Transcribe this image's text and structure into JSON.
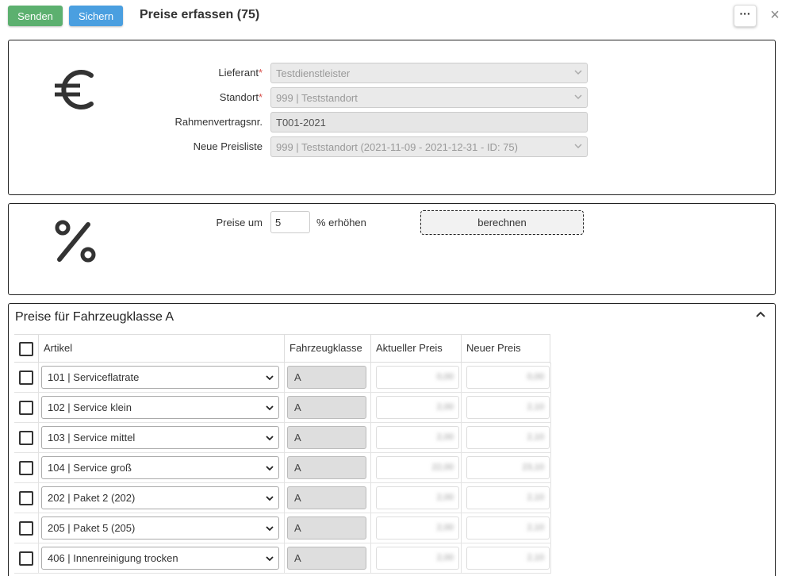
{
  "toolbar": {
    "send_label": "Senden",
    "save_label": "Sichern",
    "title": "Preise erfassen (75)",
    "more_label": "···",
    "close_label": "×"
  },
  "form": {
    "supplier": {
      "label": "Lieferant",
      "required": "*",
      "value": "Testdienstleister"
    },
    "location": {
      "label": "Standort",
      "required": "*",
      "value": "999 | Teststandort"
    },
    "contract": {
      "label": "Rahmenvertragsnr.",
      "value": "T001-2021"
    },
    "pricelist": {
      "label": "Neue Preisliste",
      "value": "999 | Teststandort (2021-11-09 - 2021-12-31 - ID: 75)"
    }
  },
  "increase": {
    "label": "Preise um",
    "value": "5",
    "suffix": "% erhöhen",
    "button": "berechnen"
  },
  "prices": {
    "title": "Preise für Fahrzeugklasse A",
    "columns": [
      "Artikel",
      "Fahrzeugklasse",
      "Aktueller Preis",
      "Neuer Preis"
    ],
    "rows": [
      {
        "article": "101 | Serviceflatrate",
        "class": "A",
        "current": "0,00",
        "new": "0,00"
      },
      {
        "article": "102 | Service klein",
        "class": "A",
        "current": "2,00",
        "new": "2,10"
      },
      {
        "article": "103 | Service mittel",
        "class": "A",
        "current": "2,00",
        "new": "2,10"
      },
      {
        "article": "104 | Service groß",
        "class": "A",
        "current": "22,00",
        "new": "23,10"
      },
      {
        "article": "202 | Paket 2 (202)",
        "class": "A",
        "current": "2,00",
        "new": "2,10"
      },
      {
        "article": "205 | Paket 5 (205)",
        "class": "A",
        "current": "2,00",
        "new": "2,10"
      },
      {
        "article": "406 | Innenreinigung trocken",
        "class": "A",
        "current": "2,00",
        "new": "2,10"
      }
    ]
  },
  "colors": {
    "send": "#5cb06f",
    "save": "#4a9fe0",
    "required": "#d9534f"
  }
}
